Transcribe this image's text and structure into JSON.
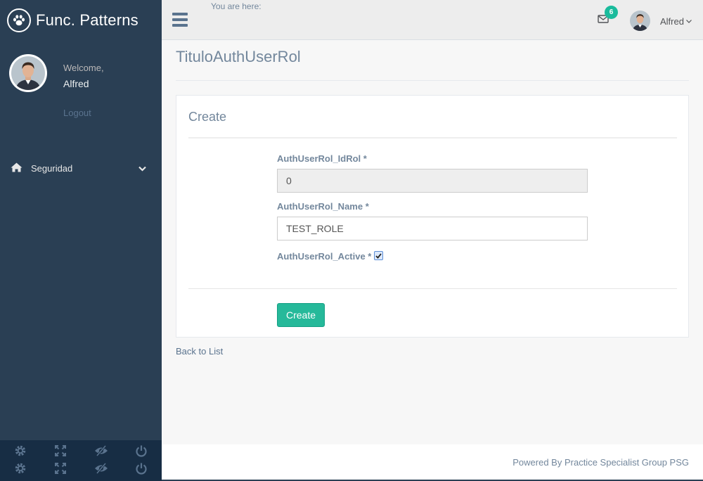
{
  "brand": {
    "name": "Func. Patterns",
    "icon": "paw-icon"
  },
  "profile": {
    "welcome": "Welcome,",
    "name": "Alfred",
    "logout": "Logout"
  },
  "menu": {
    "items": [
      {
        "label": "Seguridad",
        "icon": "home-icon"
      }
    ]
  },
  "topnav": {
    "breadcrumb": "You are here:",
    "mail_count": "6",
    "user": "Alfred"
  },
  "page": {
    "title": "TituloAuthUserRol"
  },
  "form": {
    "title": "Create",
    "fields": [
      {
        "label": "AuthUserRol_IdRol *",
        "value": "0"
      },
      {
        "label": "AuthUserRol_Name *",
        "value": "TEST_ROLE"
      },
      {
        "label": "AuthUserRol_Active *",
        "checked": true
      }
    ],
    "submit": "Create"
  },
  "back_link": "Back to List",
  "footer": {
    "text": "Powered By Practice Specialist Group PSG"
  },
  "colors": {
    "sidebar": "#2a3f54",
    "accent": "#26b99a",
    "badge": "#1abb9c"
  }
}
